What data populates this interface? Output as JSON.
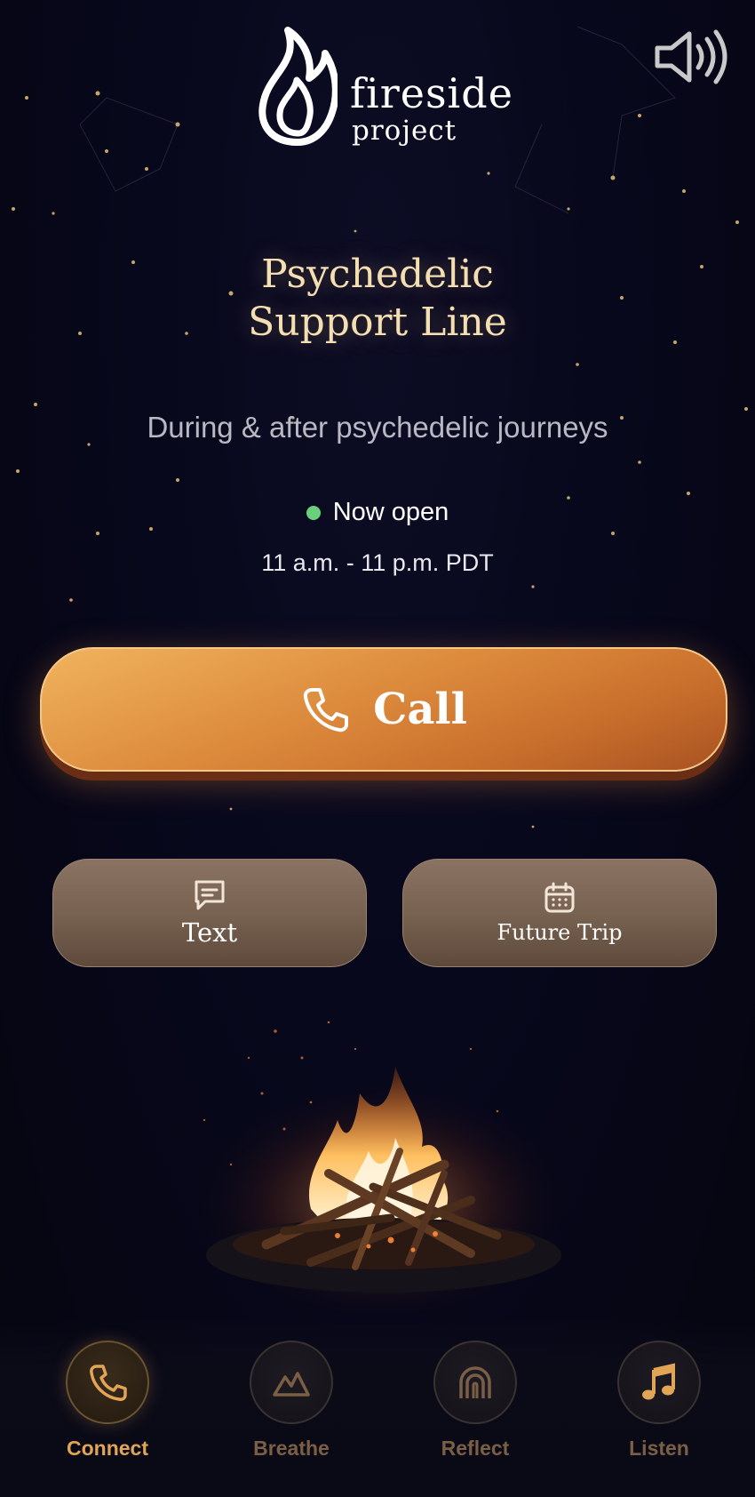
{
  "brand": {
    "name_line1": "fireside",
    "name_line2": "project"
  },
  "header": {
    "sound_icon": "speaker-volume-icon"
  },
  "hero": {
    "title_line1": "Psychedelic",
    "title_line2": "Support Line",
    "subtitle": "During & after psychedelic journeys",
    "status_text": "Now open",
    "status_color": "#6bd07b",
    "hours": "11 a.m. - 11 p.m. PDT"
  },
  "actions": {
    "call_label": "Call",
    "call_icon": "phone-icon",
    "text_label": "Text",
    "text_icon": "chat-bubble-icon",
    "future_trip_label": "Future Trip",
    "future_trip_icon": "calendar-icon"
  },
  "nav": {
    "items": [
      {
        "label": "Connect",
        "icon": "phone-icon",
        "active": true
      },
      {
        "label": "Breathe",
        "icon": "mountain-icon",
        "active": false
      },
      {
        "label": "Reflect",
        "icon": "arch-icon",
        "active": false
      },
      {
        "label": "Listen",
        "icon": "music-note-icon",
        "active": false
      }
    ]
  },
  "colors": {
    "accent": "#e2a455",
    "call_button": "#dc8a3c",
    "title": "#f4dfb2"
  }
}
